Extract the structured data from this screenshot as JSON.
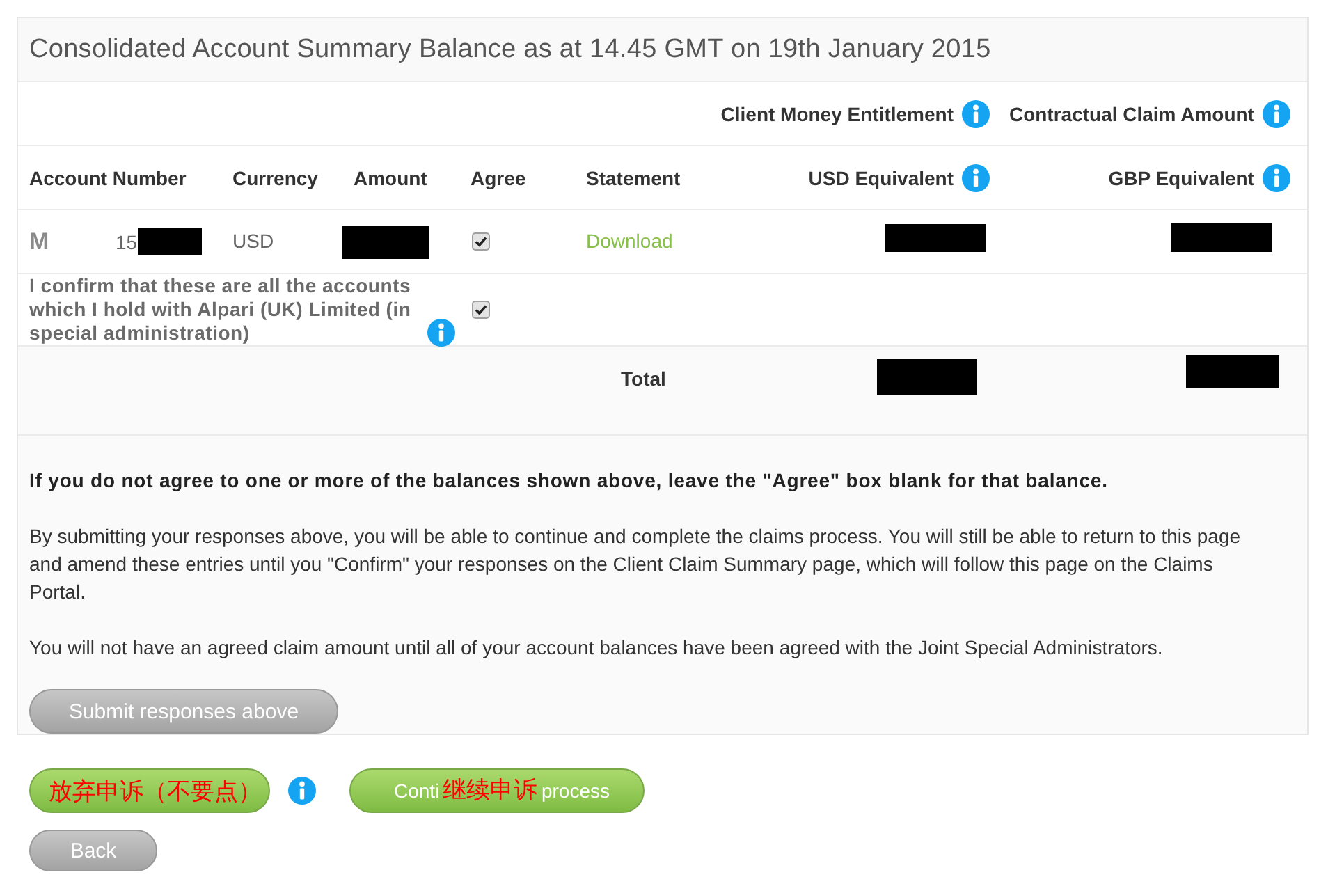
{
  "title": "Consolidated Account Summary Balance as at 14.45 GMT on 19th January 2015",
  "group_headers": [
    {
      "label": "Client Money Entitlement",
      "info": true
    },
    {
      "label": "Contractual Claim Amount",
      "info": true
    }
  ],
  "columns": [
    {
      "label": "Account Number",
      "info": false
    },
    {
      "label": "Currency",
      "info": false
    },
    {
      "label": "Amount",
      "info": false
    },
    {
      "label": "Agree",
      "info": false
    },
    {
      "label": "Statement",
      "info": false
    },
    {
      "label": "USD Equivalent",
      "info": true
    },
    {
      "label": "GBP Equivalent",
      "info": true
    }
  ],
  "rows": [
    {
      "type_mark": "M",
      "account_number": "15",
      "account_redacted": true,
      "currency": "USD",
      "amount_redacted": true,
      "agree": true,
      "statement": "Download",
      "usd_redacted": true,
      "gbp_redacted": true
    }
  ],
  "confirmation": {
    "text": "I confirm that these are all the accounts which I hold with Alpari (UK) Limited (in special administration)",
    "info": true,
    "checked": true
  },
  "total": {
    "label": "Total",
    "usd_redacted": true,
    "gbp_redacted": true
  },
  "notes": [
    {
      "kind": "bold",
      "text": "If you do not agree to one or more of the balances shown above, leave the \"Agree\" box blank for that balance."
    },
    {
      "kind": "plain",
      "text": "By submitting your responses above, you will be able to continue and complete the claims process. You will still be able to return to this page and amend these entries until you \"Confirm\" your responses on the Client Claim Summary page, which will follow this page on the Claims Portal."
    },
    {
      "kind": "plain",
      "text": "You will not have an agreed claim amount until all of your account balances have been agreed with the Joint Special Administrators."
    }
  ],
  "submit_button": "Submit responses above",
  "actions": [
    {
      "info": true,
      "annotation": "放弃申诉（不要点）"
    },
    {
      "label_parts": [
        "Conti",
        "process"
      ],
      "info": false,
      "annotation": "继续申诉"
    }
  ],
  "back_button": "Back"
}
